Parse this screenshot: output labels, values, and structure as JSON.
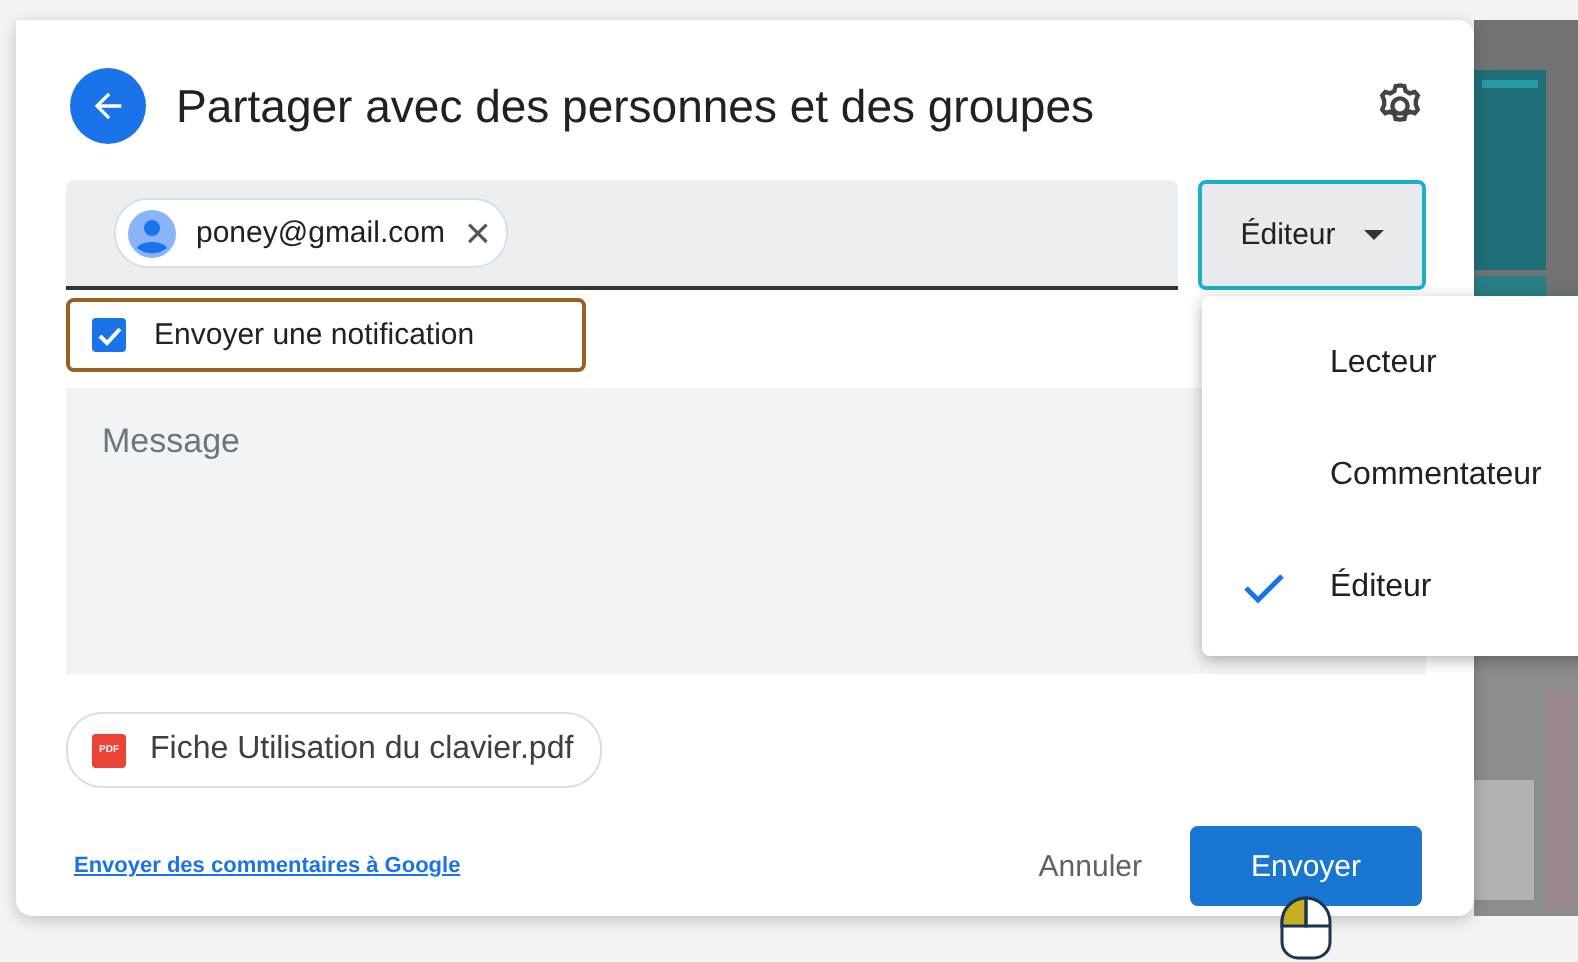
{
  "dialog": {
    "title": "Partager avec des personnes et des groupes"
  },
  "recipient": {
    "email": "poney@gmail.com",
    "remove": "×"
  },
  "role_button": {
    "label": "Éditeur",
    "expanded": true
  },
  "notify": {
    "label": "Envoyer une notification",
    "checked": true
  },
  "message": {
    "placeholder": "Message"
  },
  "attachment": {
    "badge": "PDF",
    "name": "Fiche Utilisation du clavier.pdf"
  },
  "feedback_link": "Envoyer des commentaires à Google",
  "buttons": {
    "cancel": "Annuler",
    "send": "Envoyer"
  },
  "role_menu": [
    {
      "label": "Lecteur",
      "selected": false
    },
    {
      "label": "Commentateur",
      "selected": false
    },
    {
      "label": "Éditeur",
      "selected": true
    }
  ]
}
